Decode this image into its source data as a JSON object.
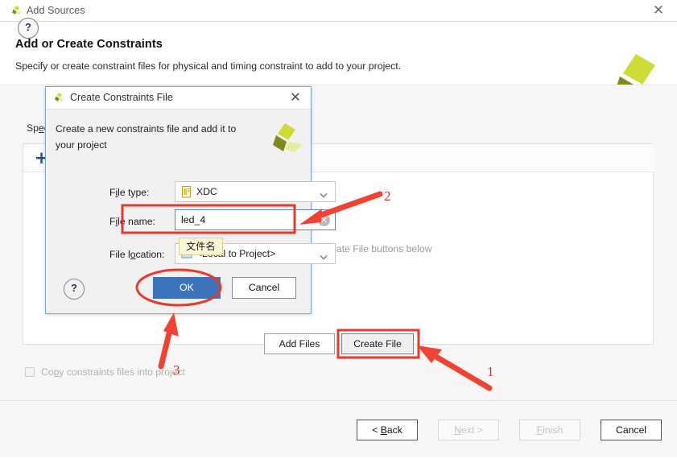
{
  "window": {
    "title": "Add Sources",
    "icon": "vivado-logo-icon",
    "close_label": "✕"
  },
  "wizard": {
    "title": "Add or Create Constraints",
    "subtitle": "Specify or create constraint files for physical and timing constraint to add to your project.",
    "specify_label_pre": "Sp",
    "specify_label_u": "e",
    "specify_label_post": "cify",
    "sources_empty_text": "Use Add Files or Create File buttons below",
    "plus_button": "+",
    "add_files_label": "Add Files",
    "create_file_label": "Create File",
    "copy_checkbox_pre": "Co",
    "copy_checkbox_u": "p",
    "copy_checkbox_post": "y constraints files into project",
    "help_label": "?"
  },
  "footer": {
    "back_pre": "< ",
    "back_u": "B",
    "back_post": "ack",
    "next_u": "N",
    "next_post": "ext >",
    "finish_u": "F",
    "finish_post": "inish",
    "cancel_label": "Cancel"
  },
  "dialog": {
    "title": "Create Constraints File",
    "icon": "vivado-logo-icon",
    "close_label": "✕",
    "description": "Create a new constraints file and add it to your project",
    "help_label": "?",
    "file_type": {
      "label_pre": "F",
      "label_u": "i",
      "label_post": "le type:",
      "value": "XDC",
      "icon": "xdc-file-icon"
    },
    "file_name": {
      "label_pre": "F",
      "label_u": "i",
      "label_post": "le name:",
      "value": "led_4",
      "clear_label": "✕"
    },
    "file_location": {
      "label_pre": "File l",
      "label_u": "o",
      "label_post": "cation:",
      "value": "<Local to Project>",
      "icon": "folder-icon"
    },
    "ok_label": "OK",
    "cancel_label": "Cancel"
  },
  "tooltip": {
    "file_name_tip": "文件名"
  },
  "annotations": {
    "one": "1",
    "two": "2",
    "three": "3",
    "color": "#d92b2b"
  },
  "colors": {
    "accent_blue": "#3d73bb",
    "annotation_red": "#e13b2e",
    "brand_green": "#c5d92d",
    "brand_olive": "#7f8a1e",
    "tooltip_bg": "#fdf7d6"
  }
}
